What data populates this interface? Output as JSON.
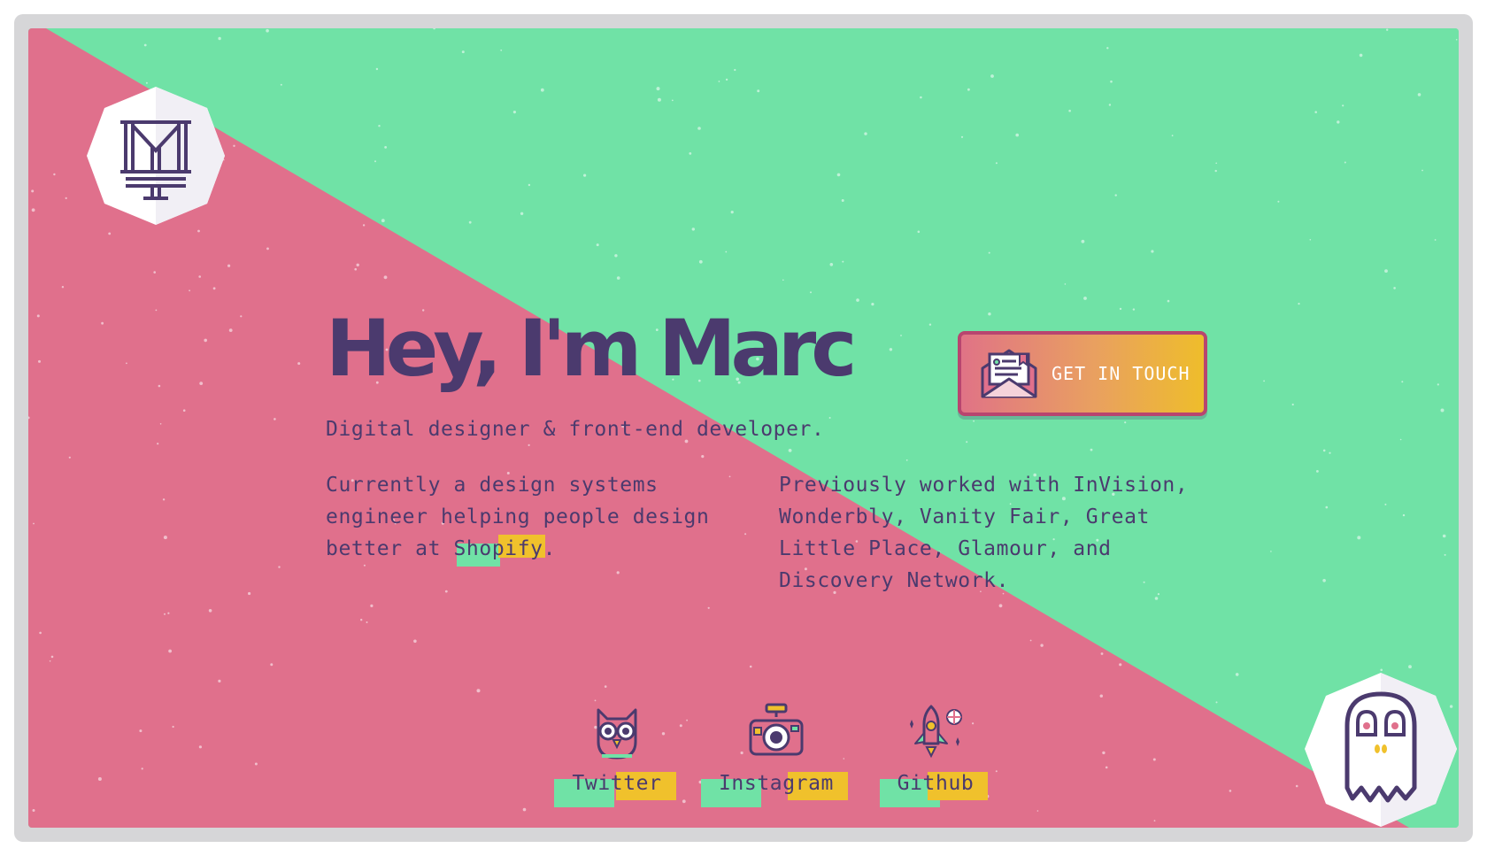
{
  "colors": {
    "mint": "#70e2a6",
    "rose": "#e0708c",
    "purple": "#4b3a6e",
    "gold": "#f0c12c",
    "frame": "#d6d6d8"
  },
  "logo": {
    "icon": "mh-monogram-icon"
  },
  "hero": {
    "title": "Hey, I'm Marc",
    "tagline": "Digital designer & front-end developer."
  },
  "about": {
    "current_prefix": "Currently a design systems engineer helping people design better at ",
    "current_company": "Shopify",
    "current_suffix": ".",
    "previous": "Previously worked with InVision, Wonderbly, Vanity Fair, Great Little Place, Glamour, and Discovery Network."
  },
  "cta": {
    "label": "GET IN TOUCH",
    "icon": "envelope-letter-icon"
  },
  "social": [
    {
      "label": "Twitter",
      "icon": "owl-icon"
    },
    {
      "label": "Instagram",
      "icon": "camera-icon"
    },
    {
      "label": "Github",
      "icon": "rocket-icon"
    }
  ],
  "mascot": {
    "icon": "ghost-skull-icon"
  }
}
